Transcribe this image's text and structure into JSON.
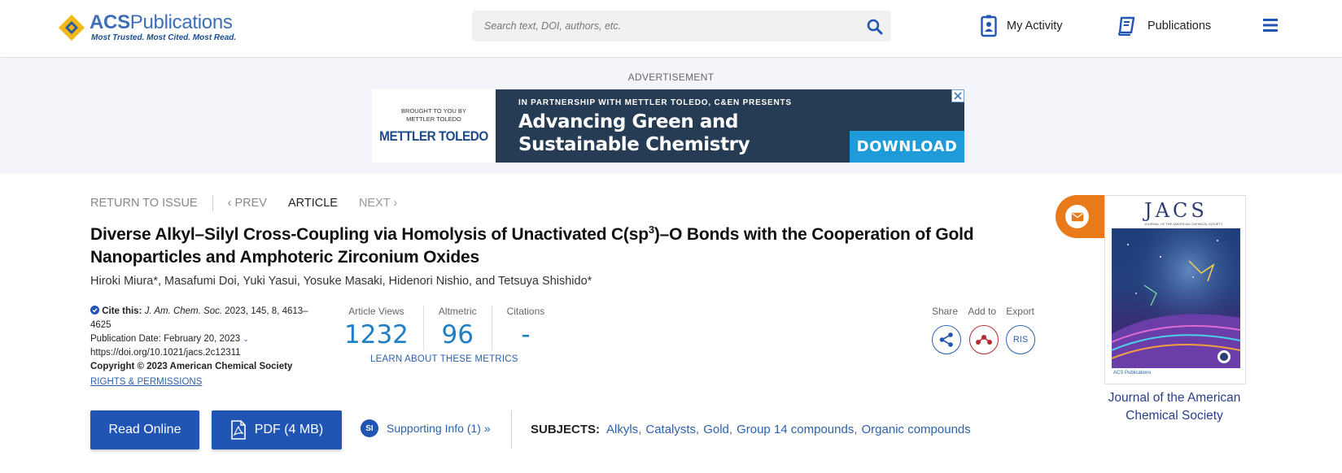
{
  "header": {
    "logo_name_bold": "ACS",
    "logo_name_rest": "Publications",
    "logo_tagline": "Most Trusted. Most Cited. Most Read.",
    "search_placeholder": "Search text, DOI, authors, etc.",
    "my_activity_label": "My Activity",
    "publications_label": "Publications"
  },
  "ad": {
    "label": "ADVERTISEMENT",
    "brought_line1": "BROUGHT TO YOU BY",
    "brought_line2": "METTLER TOLEDO",
    "sponsor": "METTLER TOLEDO",
    "partner_text": "IN PARTNERSHIP WITH METTLER TOLEDO, C&EN PRESENTS",
    "headline_line1": "Advancing Green and",
    "headline_line2": "Sustainable Chemistry",
    "cta": "DOWNLOAD"
  },
  "article_nav": {
    "return_label": "RETURN TO ISSUE",
    "prev_label": "PREV",
    "current_label": "ARTICLE",
    "next_label": "NEXT"
  },
  "article": {
    "title_part1": "Diverse Alkyl–Silyl Cross-Coupling via Homolysis of Unactivated C(sp",
    "title_sup": "3",
    "title_part2": ")–O Bonds with the Cooperation of Gold Nanoparticles and Amphoteric Zirconium Oxides",
    "authors": "Hiroki Miura*, Masafumi Doi, Yuki Yasui, Yosuke Masaki, Hidenori Nishio, and Tetsuya Shishido*"
  },
  "cite": {
    "cite_label": "Cite this:",
    "journal": "J. Am. Chem. Soc.",
    "citation": "2023, 145, 8, 4613–4625",
    "pub_date": "Publication Date: February 20, 2023",
    "doi": "https://doi.org/10.1021/jacs.2c12311",
    "copyright": "Copyright © 2023 American Chemical Society",
    "rights": "RIGHTS & PERMISSIONS"
  },
  "metrics": {
    "views_label": "Article Views",
    "views_value": "1232",
    "altmetric_label": "Altmetric",
    "altmetric_value": "96",
    "citations_label": "Citations",
    "citations_value": "-",
    "learn_label": "LEARN ABOUT THESE METRICS"
  },
  "share": {
    "share_label": "Share",
    "addto_label": "Add to",
    "export_label": "Export",
    "ris_label": "RIS"
  },
  "actions": {
    "read_online": "Read Online",
    "pdf": "PDF (4 MB)",
    "si_badge": "SI",
    "supporting_info": "Supporting Info (1) »"
  },
  "subjects": {
    "heading": "SUBJECTS:",
    "items": [
      "Alkyls",
      "Catalysts",
      "Gold",
      "Group 14 compounds",
      "Organic compounds"
    ]
  },
  "cover": {
    "journal_abbrev": "JACS",
    "journal_name": "JOURNAL OF THE AMERICAN CHEMICAL SOCIETY",
    "footer": "ACS Publications",
    "caption": "Journal of the American Chemical Society"
  },
  "colors": {
    "brand_blue": "#2155b3",
    "link_blue": "#2b62ae",
    "metric_blue": "#1f7fc6",
    "orange": "#e87a1a",
    "ad_navy": "#263c55",
    "ad_cta": "#1e9bd8"
  }
}
